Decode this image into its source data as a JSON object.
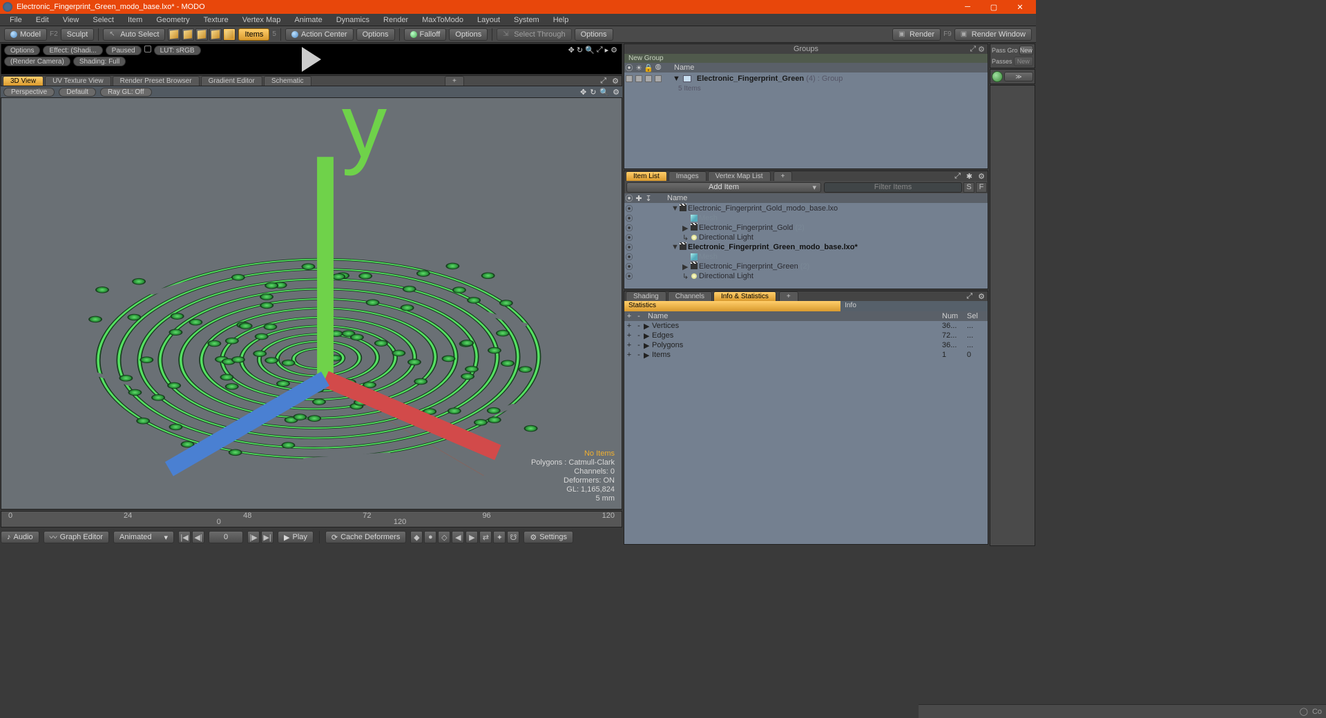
{
  "title_bar": {
    "title": "Electronic_Fingerprint_Green_modo_base.lxo* - MODO"
  },
  "menu": [
    "File",
    "Edit",
    "View",
    "Select",
    "Item",
    "Geometry",
    "Texture",
    "Vertex Map",
    "Animate",
    "Dynamics",
    "Render",
    "MaxToModo",
    "Layout",
    "System",
    "Help"
  ],
  "toolbar": {
    "model": "Model",
    "model_key": "F2",
    "sculpt": "Sculpt",
    "auto_select": "Auto Select",
    "items": "Items",
    "items_key": "5",
    "action_center": "Action Center",
    "ac_options": "Options",
    "falloff": "Falloff",
    "fo_options": "Options",
    "select_through": "Select Through",
    "st_options": "Options",
    "render": "Render",
    "render_key": "F9",
    "render_window": "Render Window"
  },
  "preview": {
    "options": "Options",
    "effect": "Effect: (Shadi...",
    "paused": "Paused",
    "lut": "LUT: sRGB",
    "camera": "(Render Camera)",
    "shading": "Shading: Full"
  },
  "view_tabs": [
    "3D View",
    "UV Texture View",
    "Render Preset Browser",
    "Gradient Editor",
    "Schematic"
  ],
  "view_sub": {
    "mode": "Perspective",
    "profile": "Default",
    "raygl": "Ray GL: Off"
  },
  "viewport_overlay": {
    "no_items": "No Items",
    "polygons": "Polygons : Catmull-Clark",
    "channels": "Channels: 0",
    "deformers": "Deformers: ON",
    "gl": "GL: 1,165,824",
    "unit": "5 mm"
  },
  "timeline": {
    "ticks": [
      "0",
      "24",
      "48",
      "72",
      "96",
      "120"
    ],
    "mid_start": "0",
    "mid_end": "120"
  },
  "bottom": {
    "audio": "Audio",
    "graph": "Graph Editor",
    "animated": "Animated",
    "frame": "0",
    "play": "Play",
    "cache": "Cache Deformers",
    "settings": "Settings"
  },
  "groups": {
    "title": "Groups",
    "new_group": "New Group",
    "cols": [
      "⦿",
      "☀",
      "🔒",
      "⦾",
      "Name"
    ],
    "row": {
      "name": "Electronic_Fingerprint_Green",
      "count": "(4)",
      "type": ": Group",
      "sub": "5 Items"
    }
  },
  "item_tabs": [
    "Item List",
    "Images",
    "Vertex Map List"
  ],
  "item_toolbar": {
    "add": "Add Item",
    "filter": "Filter Items",
    "s": "S",
    "f": "F"
  },
  "item_cols": [
    "⦿",
    "✚",
    "↧",
    "",
    "Name"
  ],
  "items_tree": [
    {
      "lvl": 0,
      "expand": "▼",
      "type": "clap",
      "label": "Electronic_Fingerprint_Gold_modo_base.lxo",
      "bold": false
    },
    {
      "lvl": 1,
      "expand": "",
      "type": "cube",
      "label": "Mesh",
      "dim": true
    },
    {
      "lvl": 1,
      "expand": "▶",
      "type": "clap",
      "label": "Electronic_Fingerprint_Gold",
      "suffix": "(2)"
    },
    {
      "lvl": 1,
      "expand": "",
      "type": "bulb",
      "label": "Directional Light",
      "arrow": "↳"
    },
    {
      "lvl": 0,
      "expand": "▼",
      "type": "clap",
      "label": "Electronic_Fingerprint_Green_modo_base.lxo*",
      "bold": true
    },
    {
      "lvl": 1,
      "expand": "",
      "type": "cube",
      "label": "Mesh",
      "dim": true
    },
    {
      "lvl": 1,
      "expand": "▶",
      "type": "clap",
      "label": "Electronic_Fingerprint_Green",
      "suffix": "(2)"
    },
    {
      "lvl": 1,
      "expand": "",
      "type": "bulb",
      "label": "Directional Light",
      "arrow": "↳"
    }
  ],
  "stat_tabs": [
    "Shading",
    "Channels",
    "Info & Statistics"
  ],
  "stat_sub": {
    "stats": "Statistics",
    "info": "Info"
  },
  "stat_cols": {
    "plus": "+",
    "minus": "-",
    "name": "Name",
    "num": "Num",
    "sel": "Sel"
  },
  "stat_rows": [
    {
      "name": "Vertices",
      "num": "36...",
      "sel": "..."
    },
    {
      "name": "Edges",
      "num": "72...",
      "sel": "..."
    },
    {
      "name": "Polygons",
      "num": "36...",
      "sel": "..."
    },
    {
      "name": "Items",
      "num": "1",
      "sel": "0"
    }
  ],
  "passes": {
    "label": "Pass Gro",
    "new": "New",
    "passes": "Passes",
    "new2": "New",
    "arrows": "≫"
  },
  "status": {
    "co": "Co"
  }
}
